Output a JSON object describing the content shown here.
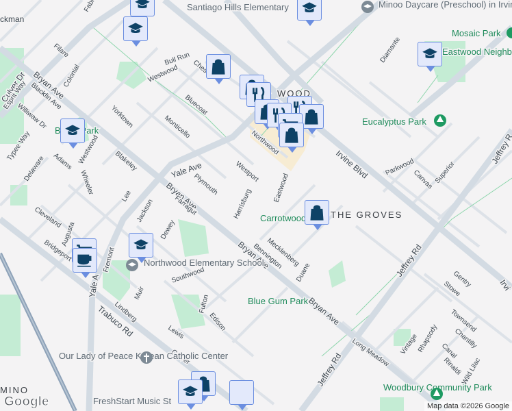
{
  "map": {
    "streets": [
      "Bryan Ave",
      "Bryan Ave",
      "Bryan Ave",
      "Bryan Ave",
      "Irvine Blvd",
      "Trabuco Rd",
      "Yale Ave",
      "Yale A",
      "Jeffrey Rd",
      "Jeffrey Rd",
      "Jeffrey R",
      "Culver Dr",
      "Esprit Way",
      "Blackfin Ave",
      "Williwaw Dr",
      "Typee Way",
      "Delaware",
      "Adams",
      "Westwood",
      "Wheeler",
      "Blakeley",
      "Lee",
      "Yorktown",
      "Monticello",
      "Bluecoat",
      "Westwood",
      "Bull Run",
      "Colonial",
      "Filare",
      "Fabri",
      "Northwood",
      "Westport",
      "Harrisburg",
      "Plymouth",
      "Eastwood",
      "Jackson",
      "Farragut",
      "Dewey",
      "Cleveland",
      "Augusta",
      "Bridgeport",
      "Fremont",
      "Muir",
      "Southwood",
      "Fulton",
      "Edison",
      "Lindberg",
      "Lewis",
      "Carver",
      "Mecklenberg",
      "Bennington",
      "Duane",
      "Diamante",
      "Parkwood",
      "Canvas",
      "Superior",
      "Gentry",
      "Stowe",
      "Townsend",
      "Chantilly",
      "Vintage",
      "Rhapsody",
      "Canal",
      "Rinaldi",
      "Wild Lilac",
      "Long Meadow",
      "ckman",
      "Ches",
      "Irvi"
    ],
    "parks": [
      "Mosaic Park",
      "Eastwood Neighborhood Park",
      "Eucalyptus Park",
      "Carrotwood Park",
      "Blue Gum Park",
      "Woodbury Community Park",
      "Bryan Park"
    ],
    "places": [
      "Santiago Hills Elementary",
      "Minoo Daycare (Preschool) in Irvine...",
      "Northwood Elementary School",
      "Our Lady of Peace Korean Catholic Center",
      "FreshStart Music St"
    ],
    "neighborhoods": [
      "THE GROVES",
      "WOOD",
      "MINO"
    ],
    "markers": [
      "school",
      "school",
      "school",
      "shopping",
      "shopping",
      "restaurant",
      "restaurant",
      "shopping",
      "grocery",
      "shopping",
      "shopping",
      "grocery",
      "coffee",
      "school",
      "shopping",
      "school",
      "school"
    ],
    "attribution": "Map data ©2026 Google",
    "logo": "Google"
  }
}
